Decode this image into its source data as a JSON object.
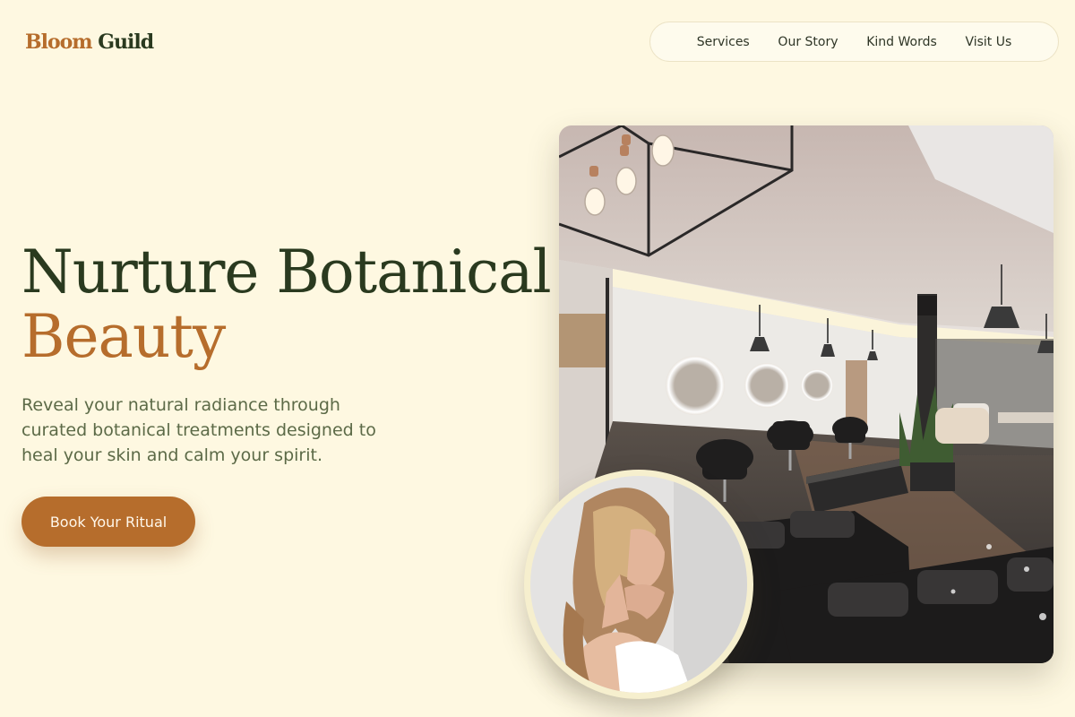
{
  "brand": {
    "word1": "Bloom",
    "word2": "Guild"
  },
  "nav": {
    "items": [
      {
        "label": "Services"
      },
      {
        "label": "Our Story"
      },
      {
        "label": "Kind Words"
      },
      {
        "label": "Visit Us"
      }
    ]
  },
  "hero": {
    "headline_line1": "Nurture Botanical",
    "headline_line2": "Beauty",
    "subtext": "Reveal your natural radiance through curated botanical treatments designed to heal your skin and calm your spirit.",
    "cta_label": "Book Your Ritual"
  },
  "colors": {
    "background": "#fef8e1",
    "accent": "#b66d2c",
    "heading": "#2a3a1f",
    "body_text": "#5c6a47"
  }
}
